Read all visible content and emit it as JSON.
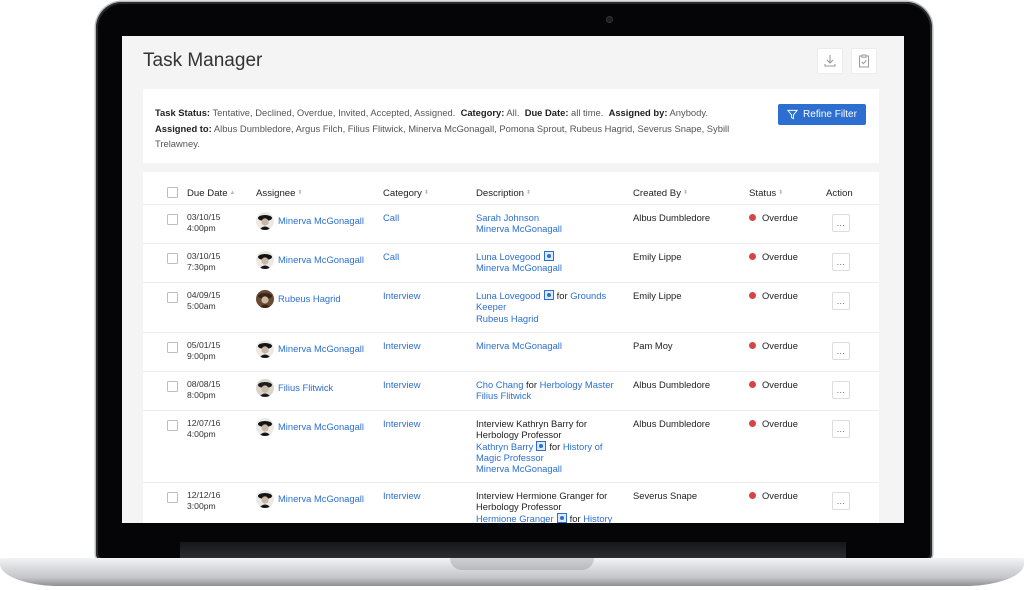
{
  "app": {
    "title": "Task Manager",
    "icons": {
      "download": "download-icon",
      "clipboard": "clipboard-check-icon"
    }
  },
  "filter": {
    "task_status_label": "Task Status:",
    "task_status_value": " Tentative, Declined, Overdue, Invited, Accepted, Assigned.",
    "category_label": "Category:",
    "category_value": " All.",
    "due_date_label": "Due Date:",
    "due_date_value": " all time.",
    "assigned_by_label": "Assigned by:",
    "assigned_by_value": " Anybody.",
    "assigned_to_label": "Assigned to:",
    "assigned_to_value": " Albus Dumbledore, Argus Filch, Filius Flitwick, Minerva McGonagall, Pomona Sprout, Rubeus Hagrid, Severus Snape, Sybill Trelawney.",
    "refine_button": "Refine Filter"
  },
  "table": {
    "columns": {
      "due_date": "Due Date",
      "assignee": "Assignee",
      "category": "Category",
      "description": "Description",
      "created_by": "Created By",
      "status": "Status",
      "action": "Action"
    },
    "action_label": "...",
    "rows": [
      {
        "date": "03/10/15",
        "time": "4:00pm",
        "assignee": "Minerva McGonagall",
        "category": "Call",
        "desc": [
          [
            {
              "t": "Sarah Johnson",
              "link": true
            }
          ],
          [
            {
              "t": "Minerva McGonagall",
              "link": true
            }
          ]
        ],
        "created_by": "Albus Dumbledore",
        "status": "Overdue"
      },
      {
        "date": "03/10/15",
        "time": "7:30pm",
        "assignee": "Minerva McGonagall",
        "category": "Call",
        "desc": [
          [
            {
              "t": "Luna Lovegood",
              "link": true
            },
            {
              "vcard": true
            }
          ],
          [
            {
              "t": "Minerva McGonagall",
              "link": true
            }
          ]
        ],
        "created_by": "Emily Lippe",
        "status": "Overdue"
      },
      {
        "date": "04/09/15",
        "time": "5:00am",
        "assignee": "Rubeus Hagrid",
        "category": "Interview",
        "desc": [
          [
            {
              "t": "Luna Lovegood",
              "link": true
            },
            {
              "vcard": true
            },
            {
              "t": "for ",
              "link": false
            },
            {
              "t": "Grounds",
              "link": true
            }
          ],
          [
            {
              "t": "Keeper",
              "link": true
            }
          ],
          [
            {
              "t": "Rubeus Hagrid",
              "link": true
            }
          ]
        ],
        "created_by": "Emily Lippe",
        "status": "Overdue"
      },
      {
        "date": "05/01/15",
        "time": "9:00pm",
        "assignee": "Minerva McGonagall",
        "category": "Interview",
        "desc": [
          [
            {
              "t": "Minerva McGonagall",
              "link": true
            }
          ]
        ],
        "created_by": "Pam Moy",
        "status": "Overdue"
      },
      {
        "date": "08/08/15",
        "time": "8:00pm",
        "assignee": "Filius Flitwick",
        "category": "Interview",
        "desc": [
          [
            {
              "t": "Cho Chang",
              "link": true
            },
            {
              "t": " for ",
              "link": false
            },
            {
              "t": "Herbology Master",
              "link": true
            }
          ],
          [
            {
              "t": "Filius Flitwick",
              "link": true
            }
          ]
        ],
        "created_by": "Albus Dumbledore",
        "status": "Overdue"
      },
      {
        "date": "12/07/16",
        "time": "4:00pm",
        "assignee": "Minerva McGonagall",
        "category": "Interview",
        "desc": [
          [
            {
              "t": "Interview Kathryn Barry for",
              "link": false
            }
          ],
          [
            {
              "t": "Herbology Professor",
              "link": false
            }
          ],
          [
            {
              "t": "Kathryn Barry",
              "link": true
            },
            {
              "vcard": true
            },
            {
              "t": "for ",
              "link": false
            },
            {
              "t": "History of",
              "link": true
            }
          ],
          [
            {
              "t": "Magic Professor",
              "link": true
            }
          ],
          [
            {
              "t": "Minerva McGonagall",
              "link": true
            }
          ]
        ],
        "created_by": "Albus Dumbledore",
        "status": "Overdue"
      },
      {
        "date": "12/12/16",
        "time": "3:00pm",
        "assignee": "Minerva McGonagall",
        "category": "Interview",
        "desc": [
          [
            {
              "t": "Interview Hermione Granger for",
              "link": false
            }
          ],
          [
            {
              "t": "Herbology Professor",
              "link": false
            }
          ],
          [
            {
              "t": "Hermione Granger",
              "link": true
            },
            {
              "vcard": true
            },
            {
              "t": "for ",
              "link": false
            },
            {
              "t": "History",
              "link": true
            }
          ]
        ],
        "created_by": "Severus Snape",
        "status": "Overdue"
      }
    ]
  },
  "colors": {
    "accent": "#2d6fd1",
    "link": "#2c6fd0",
    "overdue": "#d64545"
  }
}
